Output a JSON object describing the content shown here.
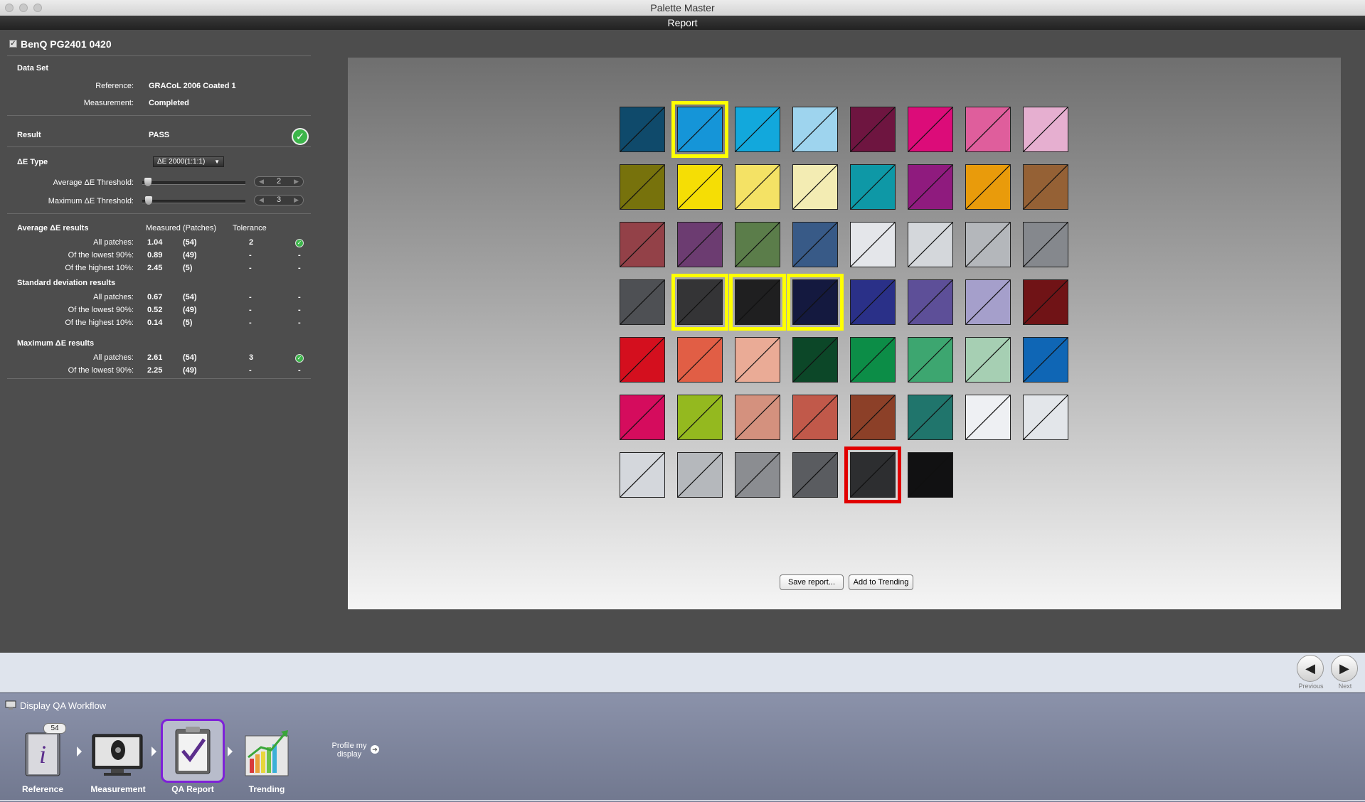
{
  "window": {
    "title": "Palette Master",
    "subtitle": "Report"
  },
  "device": {
    "name": "BenQ PG2401 0420"
  },
  "dataset": {
    "heading": "Data Set",
    "reference_label": "Reference:",
    "reference_value": "GRACoL 2006 Coated 1",
    "measurement_label": "Measurement:",
    "measurement_value": "Completed"
  },
  "result": {
    "label": "Result",
    "value": "PASS"
  },
  "de_type": {
    "label": "ΔE Type",
    "selected": "ΔE 2000(1:1:1)",
    "avg_threshold_label": "Average  ΔE Threshold:",
    "avg_threshold_value": "2",
    "max_threshold_label": "Maximum ΔE Threshold:",
    "max_threshold_value": "3"
  },
  "avg_results": {
    "heading": "Average ΔE results",
    "col_measured": "Measured (Patches)",
    "col_tolerance": "Tolerance",
    "rows": [
      {
        "label": "All patches:",
        "value": "1.04",
        "patches": "(54)",
        "tolerance": "2",
        "status": "✓"
      },
      {
        "label": "Of the lowest 90%:",
        "value": "0.89",
        "patches": "(49)",
        "tolerance": "-",
        "status": "-"
      },
      {
        "label": "Of the highest 10%:",
        "value": "2.45",
        "patches": "(5)",
        "tolerance": "-",
        "status": "-"
      }
    ]
  },
  "std_results": {
    "heading": "Standard deviation results",
    "rows": [
      {
        "label": "All patches:",
        "value": "0.67",
        "patches": "(54)",
        "tolerance": "-",
        "status": "-"
      },
      {
        "label": "Of the lowest 90%:",
        "value": "0.52",
        "patches": "(49)",
        "tolerance": "-",
        "status": "-"
      },
      {
        "label": "Of the highest 10%:",
        "value": "0.14",
        "patches": "(5)",
        "tolerance": "-",
        "status": "-"
      }
    ]
  },
  "max_results": {
    "heading": "Maximum ΔE results",
    "rows": [
      {
        "label": "All patches:",
        "value": "2.61",
        "patches": "(54)",
        "tolerance": "3",
        "status": "✓"
      },
      {
        "label": "Of the lowest 90%:",
        "value": "2.25",
        "patches": "(49)",
        "tolerance": "-",
        "status": "-"
      }
    ]
  },
  "patches": [
    [
      "#0f4a6b",
      "#1595d8",
      "#12a8dc",
      "#9ed4ee",
      "#6e1540",
      "#dc0c79",
      "#df5e9c",
      "#e6afd0"
    ],
    [
      "#77720c",
      "#f5de05",
      "#f4e265",
      "#f3ecb3",
      "#0e98a6",
      "#8f1b7e",
      "#e99b0b",
      "#956135"
    ],
    [
      "#934148",
      "#6c3c71",
      "#5b7d4a",
      "#385a87",
      "#e4e6ea",
      "#d4d7db",
      "#b4b7bb",
      "#85888d"
    ],
    [
      "#4e5054",
      "#343436",
      "#1f1f20",
      "#14193f",
      "#2a3088",
      "#5d4f98",
      "#a59fcb",
      "#701316"
    ],
    [
      "#d40f1e",
      "#e15e45",
      "#eaab96",
      "#0c4728",
      "#0c8d47",
      "#3da670",
      "#a6cfb3",
      "#0f66b5"
    ],
    [
      "#d50c5d",
      "#94b91f",
      "#d4917e",
      "#c1594a",
      "#8c4028",
      "#20756c",
      "#eef0f3",
      "#e3e6ea"
    ],
    [
      "#d4d7dc",
      "#b5b8bc",
      "#8b8d91",
      "#5a5c60",
      "#2d2e30",
      "#111112"
    ]
  ],
  "highlights": {
    "yellow": [
      "0-1",
      "3-1",
      "3-2",
      "3-3"
    ],
    "red": [
      "6-4"
    ]
  },
  "buttons": {
    "save": "Save report...",
    "trending": "Add to Trending"
  },
  "nav": {
    "previous": "Previous",
    "next": "Next",
    "previous_icon": "◀",
    "next_icon": "▶"
  },
  "workflow": {
    "heading": "Display QA Workflow",
    "badge": "54",
    "steps": [
      "Reference",
      "Measurement",
      "QA Report",
      "Trending"
    ],
    "profile_line1": "Profile my",
    "profile_line2": "display"
  }
}
